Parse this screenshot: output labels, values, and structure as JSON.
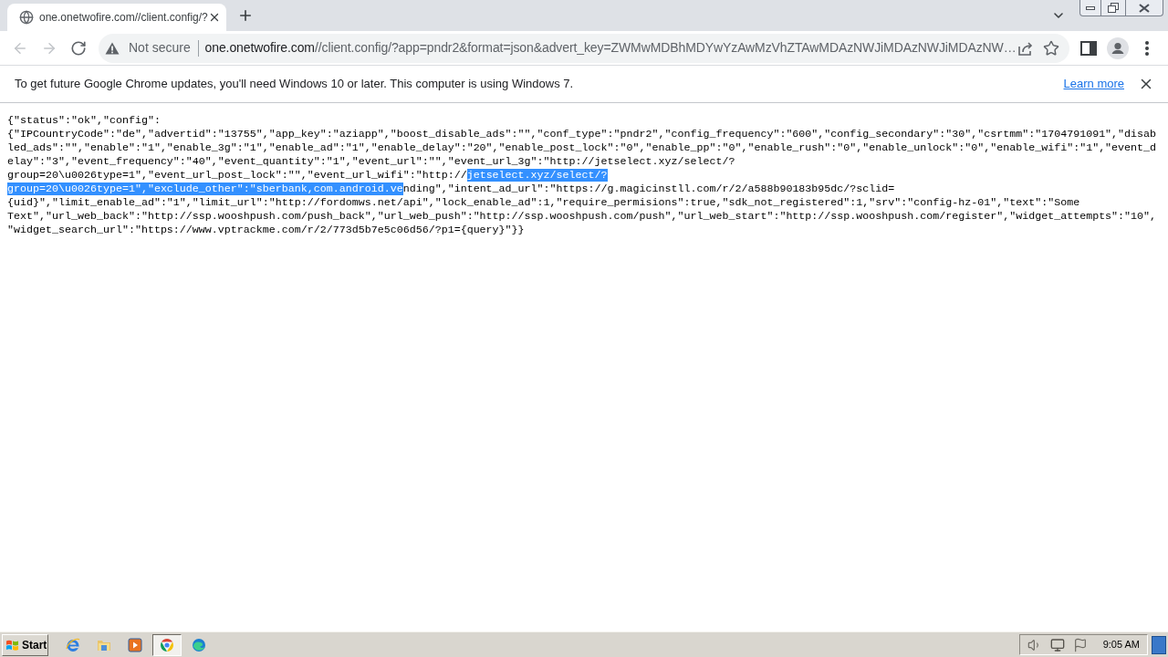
{
  "browser": {
    "tabs": [
      {
        "title": "one.onetwofire.com//client.config/?",
        "selected": true
      }
    ],
    "nav_buttons": [
      {
        "kind": "back",
        "disabled": true
      },
      {
        "kind": "forward",
        "disabled": true
      },
      {
        "kind": "reload",
        "disabled": false
      }
    ],
    "omnibox": {
      "security_label": "Not secure",
      "host": "one.onetwofire.com",
      "path": "//client.config/?app=pndr2&format=json&advert_key=ZWMwMDBhMDYwYzAwMzVhZTAwMDAzNWJiMDAzNWJiMDAzNW…"
    },
    "infobar": {
      "message": "To get future Google Chrome updates, you'll need Windows 10 or later. This computer is using Windows 7.",
      "link": "Learn more"
    }
  },
  "page": {
    "lines": [
      {
        "segments": [
          {
            "text": "{\"status\":\"ok\",\"config\":",
            "selected": false
          }
        ]
      },
      {
        "segments": [
          {
            "text": "{\"IPCountryCode\":\"de\",\"advertid\":\"13755\",\"app_key\":\"aziapp\",\"boost_disable_ads\":\"\",\"conf_type\":\"pndr2\",\"config_frequency\":\"600\",\"config_secondary\":\"30\",\"csrtmm\":\"1704791091\",\"disab",
            "selected": false
          }
        ]
      },
      {
        "segments": [
          {
            "text": "led_ads\":\"\",\"enable\":\"1\",\"enable_3g\":\"1\",\"enable_ad\":\"1\",\"enable_delay\":\"20\",\"enable_post_lock\":\"0\",\"enable_pp\":\"0\",\"enable_rush\":\"0\",\"enable_unlock\":\"0\",\"enable_wifi\":\"1\",\"event_d",
            "selected": false
          }
        ]
      },
      {
        "segments": [
          {
            "text": "elay\":\"3\",\"event_frequency\":\"40\",\"event_quantity\":\"1\",\"event_url\":\"\",\"event_url_3g\":\"http://jetselect.xyz/select/?",
            "selected": false
          }
        ]
      },
      {
        "segments": [
          {
            "text": "group=20\\u0026type=1\",\"event_url_post_lock\":\"\",\"event_url_wifi\":\"http://",
            "selected": false
          },
          {
            "text": "jetselect.xyz/select/?",
            "selected": true
          }
        ]
      },
      {
        "segments": [
          {
            "text": "group=20\\u0026type=1\",\"exclude_other\":\"sberbank,com.android.ve",
            "selected": true
          },
          {
            "text": "nding\",\"intent_ad_url\":\"https://g.magicinstll.com/r/2/a588b90183b95dc/?sclid=",
            "selected": false
          }
        ]
      },
      {
        "segments": [
          {
            "text": "{uid}\",\"limit_enable_ad\":\"1\",\"limit_url\":\"http://fordomws.net/api\",\"lock_enable_ad\":1,\"require_permisions\":true,\"sdk_not_registered\":1,\"srv\":\"config-hz-01\",\"text\":\"Some",
            "selected": false
          }
        ]
      },
      {
        "segments": [
          {
            "text": "Text\",\"url_web_back\":\"http://ssp.wooshpush.com/push_back\",\"url_web_push\":\"http://ssp.wooshpush.com/push\",\"url_web_start\":\"http://ssp.wooshpush.com/register\",\"widget_attempts\":\"10\",",
            "selected": false
          }
        ]
      },
      {
        "segments": [
          {
            "text": "\"widget_search_url\":\"https://www.vptrackme.com/r/2/773d5b7e5c06d56/?p1={query}\"}}",
            "selected": false
          }
        ]
      }
    ]
  },
  "taskbar": {
    "start_label": "Start",
    "apps": [
      {
        "kind": "ie",
        "selected": false
      },
      {
        "kind": "explorer",
        "selected": false
      },
      {
        "kind": "media",
        "selected": false
      },
      {
        "kind": "chrome",
        "selected": true
      },
      {
        "kind": "edge",
        "selected": false
      }
    ],
    "clock": "9:05 AM"
  }
}
